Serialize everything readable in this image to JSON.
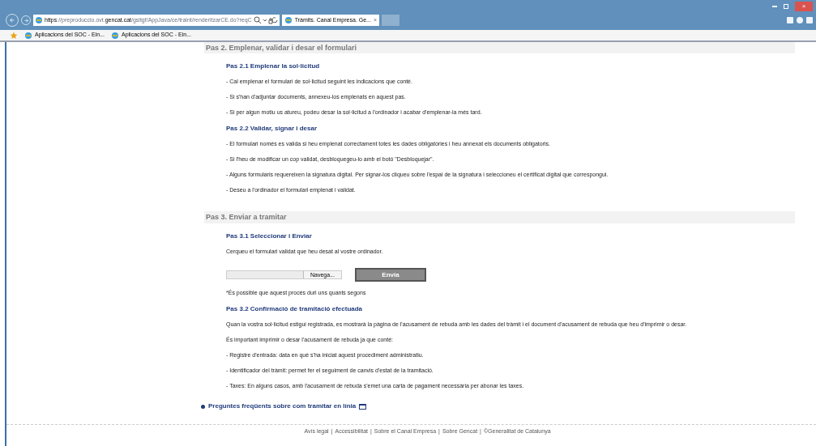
{
  "browser": {
    "window_close": "×",
    "address": [
      {
        "text": "https",
        "strong": true
      },
      {
        "text": "://preproduccio.ovt.",
        "strong": false
      },
      {
        "text": "gencat.cat",
        "strong": true
      },
      {
        "text": "/gsitgf/AppJava/ce/traint/renderitzarCE.do?reqC",
        "strong": false
      }
    ],
    "tab_title": "Tràmits. Canal Empresa. Ge...",
    "tab_close": "×",
    "favorites": [
      "Aplicacions del SOC - Ein...",
      "Aplicacions del SOC - Ein..."
    ]
  },
  "sections": [
    {
      "title": "Pas 2. Emplenar, validar i desar el formulari",
      "steps": [
        {
          "title": "Pas 2.1 Emplenar la sol·licitud",
          "lines": [
            "- Cal emplenar el formulari de sol·licitud seguint les indicacions que conté.",
            "- Si s'han d'adjuntar documents, annexeu-los emplenats en aquest pas.",
            "- Si per algun motiu us atureu, podeu desar la sol·licitud a l'ordinador i acabar d'emplenar-la més tard."
          ]
        },
        {
          "title": "Pas 2.2 Validar, signar i desar",
          "lines": [
            "- El formulari només es valida si heu emplenat correctament totes les dades obligatòries i heu annexat els documents obligatoris.",
            "- Si l'heu de modificar un cop validat, desbloquegeu-lo amb el botó \"Desbloquejar\".",
            "- Alguns formularis requereixen la signatura digital. Per signar-los cliqueu sobre l'espai de la signatura i seleccioneu el certificat digital que correspongui.",
            "- Deseu a l'ordinador el formulari emplenat i validat."
          ]
        }
      ]
    },
    {
      "title": "Pas 3. Enviar a tramitar",
      "steps": [
        {
          "title": "Pas 3.1 Seleccionar i Enviar",
          "lines": [
            "Cerqueu el formulari validat que heu desat al vostre ordinador."
          ],
          "upload": {
            "browse": "Navega...",
            "send": "Envia"
          },
          "note": "*És possible que aquest procés duri uns quants segons"
        },
        {
          "title": "Pas 3.2 Confirmació de tramitació efectuada",
          "lines": [
            "Quan la vostra sol·licitud estigui registrada, es mostrarà la pàgina de l'acusament de rebuda amb les dades del tràmit i el document d'acusament de rebuda que heu d'imprimir o desar.",
            "És important imprimir o desar l'acusament de rebuda ja que conté:",
            "- Registre d'entrada: data en què s'ha iniciat aquest procediment administratiu.",
            "- Identificador del tràmit: permet fer el seguiment de canvis d'estat de la tramitació.",
            "- Taxes: En alguns casos, amb l'acusament de rebuda s'emet una carta de pagament necessària per abonar les taxes."
          ]
        }
      ]
    }
  ],
  "faq_link": "Preguntes freqüents sobre com tramitar en línia",
  "footer_separator": "|",
  "footer": [
    "Avís legal",
    "Accessibilitat",
    "Sobre el Canal Empresa",
    "Sobre Gencat",
    "©Generalitat de Catalunya"
  ]
}
